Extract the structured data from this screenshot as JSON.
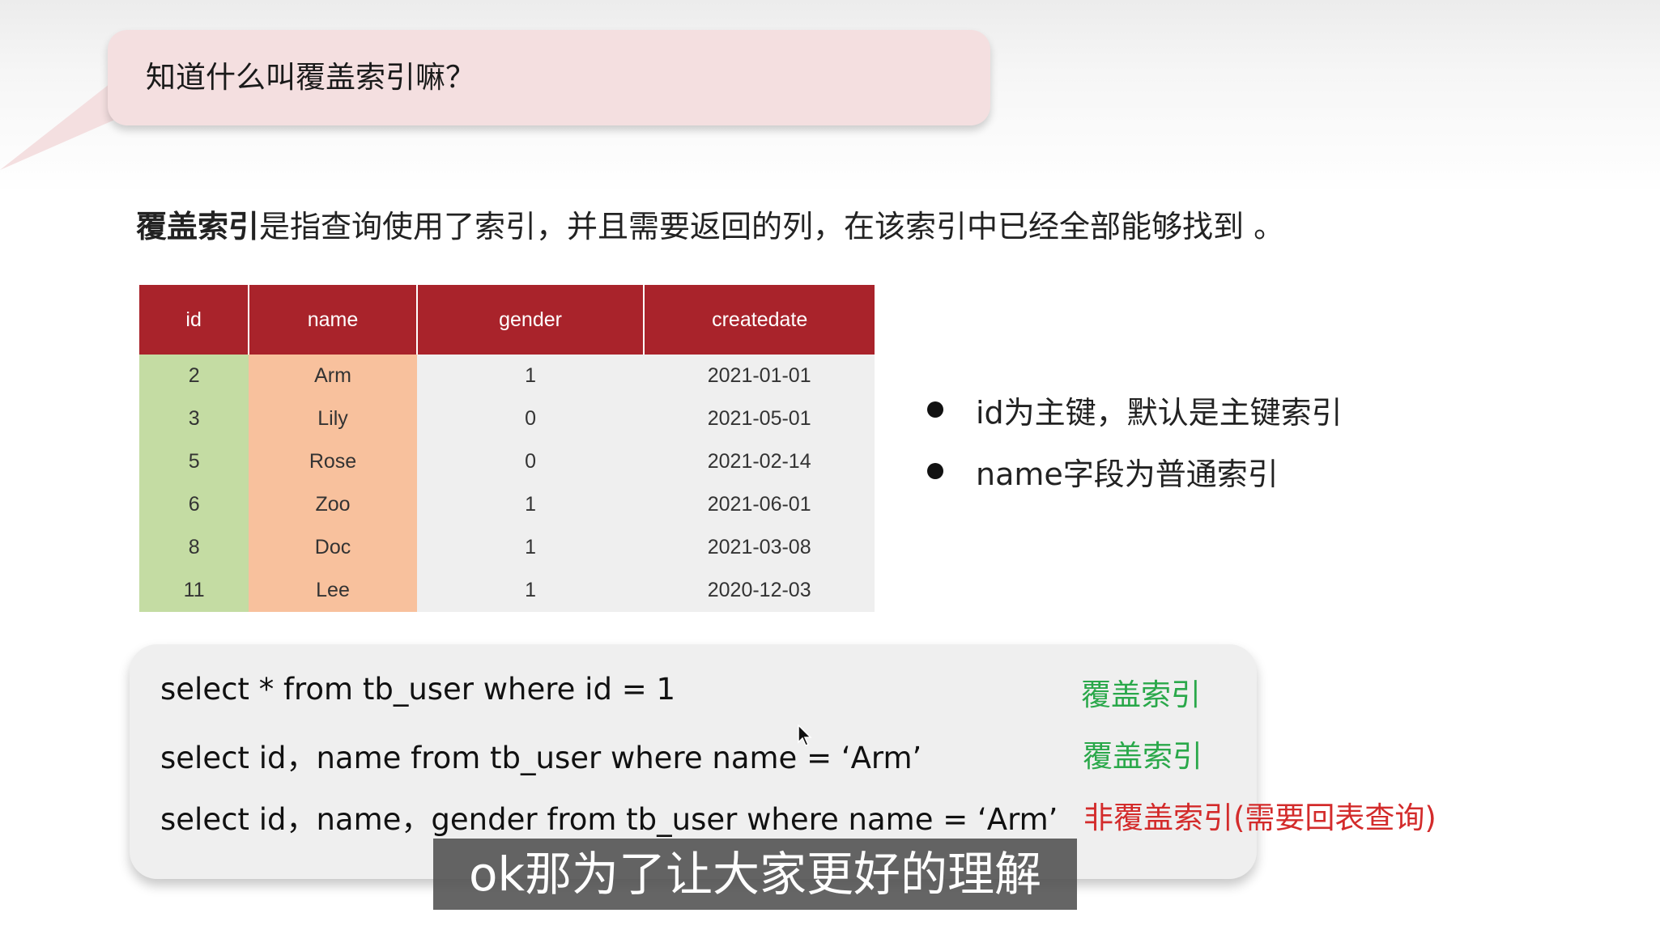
{
  "bubble": {
    "question": "知道什么叫覆盖索引嘛？"
  },
  "definition": {
    "term": "覆盖索引",
    "text": "是指查询使用了索引，并且需要返回的列，在该索引中已经全部能够找到 。"
  },
  "table": {
    "headers": [
      "id",
      "name",
      "gender",
      "createdate"
    ],
    "rows": [
      {
        "id": "2",
        "name": "Arm",
        "gender": "1",
        "createdate": "2021-01-01"
      },
      {
        "id": "3",
        "name": "Lily",
        "gender": "0",
        "createdate": "2021-05-01"
      },
      {
        "id": "5",
        "name": "Rose",
        "gender": "0",
        "createdate": "2021-02-14"
      },
      {
        "id": "6",
        "name": "Zoo",
        "gender": "1",
        "createdate": "2021-06-01"
      },
      {
        "id": "8",
        "name": "Doc",
        "gender": "1",
        "createdate": "2021-03-08"
      },
      {
        "id": "11",
        "name": "Lee",
        "gender": "1",
        "createdate": "2020-12-03"
      }
    ],
    "colors": {
      "header": "#a9232b",
      "id_column": "#c4dca3",
      "name_column": "#f8c19d",
      "other_columns": "#efefef"
    }
  },
  "bullets": [
    "id为主键，默认是主键索引",
    "name字段为普通索引"
  ],
  "queries": [
    {
      "sql": "select * from tb_user where id = 1",
      "label": "覆盖索引",
      "label_color": "green"
    },
    {
      "sql": "select id，name from tb_user where name =   ‘Arm’",
      "label": "覆盖索引",
      "label_color": "green"
    },
    {
      "sql": "select id，name，gender from tb_user where name =   ‘Arm’",
      "label": "非覆盖索引(需要回表查询)",
      "label_color": "red"
    }
  ],
  "subtitle": "ok那为了让大家更好的理解",
  "colors": {
    "bubble_bg": "#f4dfe0",
    "green_tag": "#2aa84a",
    "red_tag": "#d32b2b"
  }
}
